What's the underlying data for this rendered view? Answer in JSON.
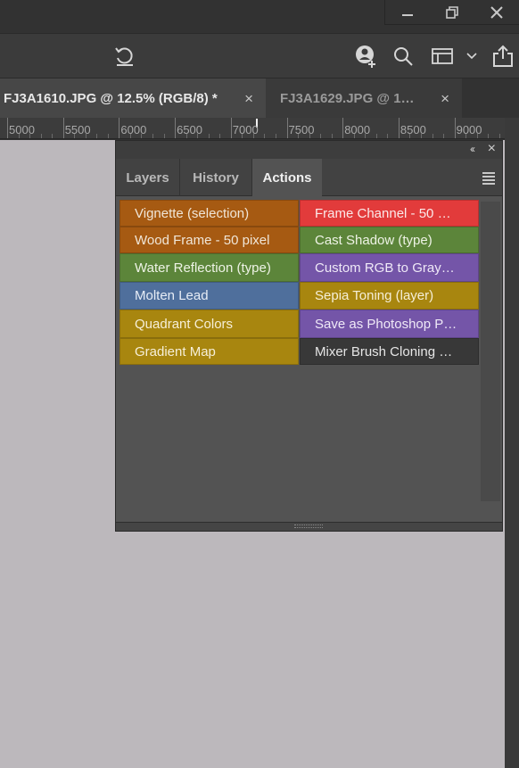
{
  "window": {
    "minimize_label": "minimize",
    "restore_label": "restore",
    "close_label": "close"
  },
  "toolbar": {
    "icons": [
      "rotate-view-icon",
      "user-add-icon",
      "search-icon",
      "workspace-icon",
      "chevron-down-icon",
      "share-icon"
    ]
  },
  "tabs": [
    {
      "title": "FJ3A1610.JPG @ 12.5% (RGB/8) *",
      "close": "×",
      "active": true
    },
    {
      "title": "FJ3A1629.JPG @ 1…",
      "close": "×",
      "active": false
    }
  ],
  "ruler": {
    "labels": [
      "5000",
      "5500",
      "6000",
      "6500",
      "7000",
      "7500",
      "8000",
      "8500",
      "9000"
    ]
  },
  "panel": {
    "collapse_glyph": "‹‹",
    "close_glyph": "×",
    "tabs": [
      "Layers",
      "History",
      "Actions"
    ],
    "active_tab": "Actions",
    "actions": [
      {
        "label": "Vignette (selection)",
        "color": "#a65a12",
        "text_color": "#f0e6d8"
      },
      {
        "label": "Frame Channel - 50 …",
        "color": "#e23b3b",
        "text_color": "#fbeaea"
      },
      {
        "label": "Wood Frame - 50 pixel",
        "color": "#a65a12",
        "text_color": "#f0e6d8"
      },
      {
        "label": "Cast Shadow (type)",
        "color": "#5c853a",
        "text_color": "#eef3e6"
      },
      {
        "label": "Water Reflection (type)",
        "color": "#5c853a",
        "text_color": "#eef3e6"
      },
      {
        "label": "Custom RGB to Gray…",
        "color": "#7455a8",
        "text_color": "#efe9f7"
      },
      {
        "label": "Molten Lead",
        "color": "#4f6f9c",
        "text_color": "#e7edf6"
      },
      {
        "label": "Sepia Toning (layer)",
        "color": "#a8860f",
        "text_color": "#f6efd8"
      },
      {
        "label": "Quadrant Colors",
        "color": "#a8860f",
        "text_color": "#f6efd8"
      },
      {
        "label": "Save as Photoshop P…",
        "color": "#7455a8",
        "text_color": "#efe9f7"
      },
      {
        "label": "Gradient Map",
        "color": "#a8860f",
        "text_color": "#f6efd8"
      },
      {
        "label": "Mixer Brush Cloning …",
        "color": "#383838",
        "text_color": "#e6e6e6"
      }
    ]
  },
  "colors": {
    "canvas": "#bcb8bc",
    "app_bg": "#323232",
    "panel_bg": "#535353"
  }
}
